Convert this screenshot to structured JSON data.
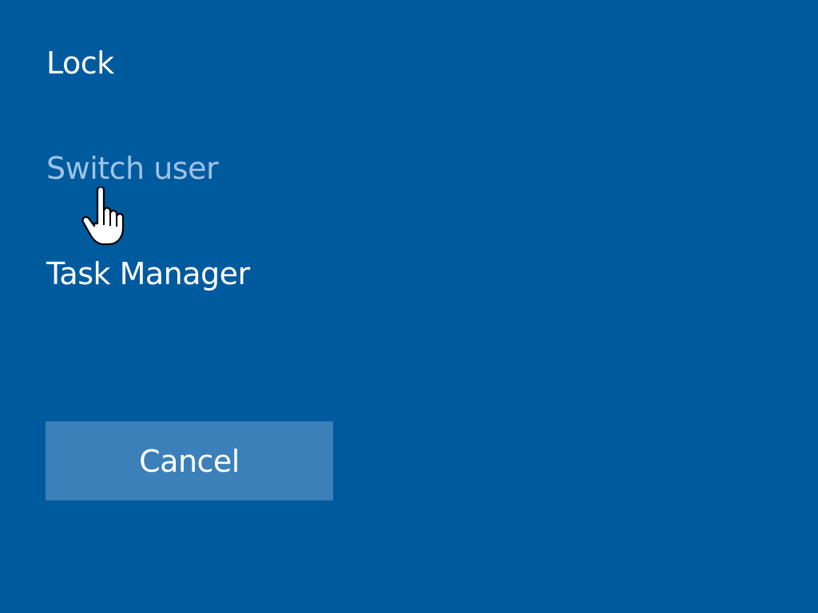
{
  "menu": {
    "items": [
      {
        "label": "Lock"
      },
      {
        "label": "Switch user"
      },
      {
        "label": "Task Manager"
      }
    ]
  },
  "cancel_button": {
    "label": "Cancel"
  },
  "colors": {
    "background": "#005a9e",
    "button_background": "#3b80b8",
    "text": "#ffffff",
    "hover_text": "#9ec3e6"
  },
  "cursor": {
    "icon": "hand-pointer-icon"
  }
}
